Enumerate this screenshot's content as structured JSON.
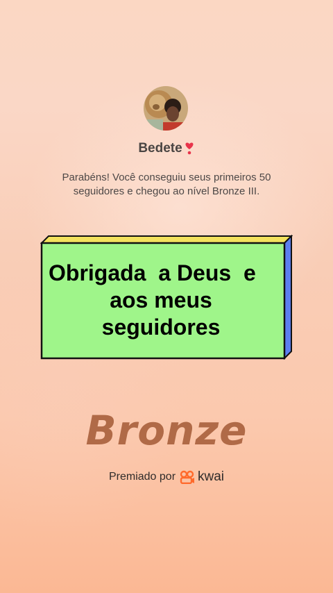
{
  "profile": {
    "name": "Bedete",
    "avatar_icon": "lion-avatar-icon",
    "heart_icon": "red-heart-icon"
  },
  "message": "Parabéns! Você conseguiu seus primeiros 50 seguidores e chegou ao nível Bronze III.",
  "banner": {
    "lines": [
      "Obrigada  a Deus  e",
      "aos meus",
      "seguidores"
    ],
    "fill_color": "#9ff58a",
    "side_color": "#5b7ff0",
    "top_color": "#f3e25d"
  },
  "level": {
    "label": "Bronze",
    "color": "#b06a47"
  },
  "footer": {
    "label": "Premiado por",
    "brand": "kwai",
    "brand_color": "#ff6a2b"
  }
}
